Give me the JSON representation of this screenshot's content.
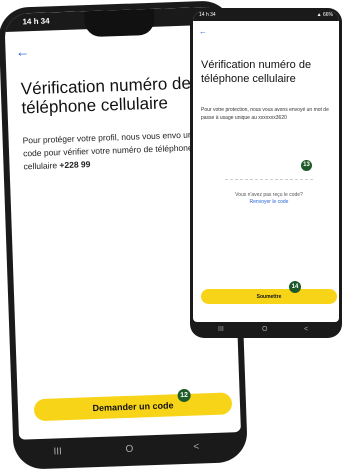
{
  "phone_back": {
    "status": {
      "time": "14 h 34",
      "icons": "▣ •",
      "right_icons": "▲ ▮▮"
    },
    "back_arrow": "←",
    "title": "Vérification numéro de téléphone cellulaire",
    "body_prefix": "Pour protéger votre profil, nous vous envo un code pour vérifier votre numéro de téléphone cellulaire",
    "body_number": "+228 99",
    "button": "Demander un code",
    "badge": "12",
    "nav": {
      "recent": "III",
      "home": "O",
      "back": "<"
    }
  },
  "phone_front": {
    "status": {
      "time": "14 h 34",
      "right_icons": "▲ 66%"
    },
    "back_arrow": "←",
    "title": "Vérification numéro de téléphone cellulaire",
    "body": "Pour votre protection, nous vous avons envoyé un mot de passe à usage unique au xxxxxxx3620",
    "badge_code": "13",
    "no_code": "Vous n'avez pas reçu le code?",
    "resend": "Renvoyer le code",
    "button": "Soumettre",
    "badge_submit": "14",
    "nav": {
      "recent": "III",
      "home": "O",
      "back": "<"
    }
  },
  "colors": {
    "accent_yellow": "#f7d417",
    "badge_green": "#1e5a2a",
    "link_blue": "#2a63d6"
  }
}
